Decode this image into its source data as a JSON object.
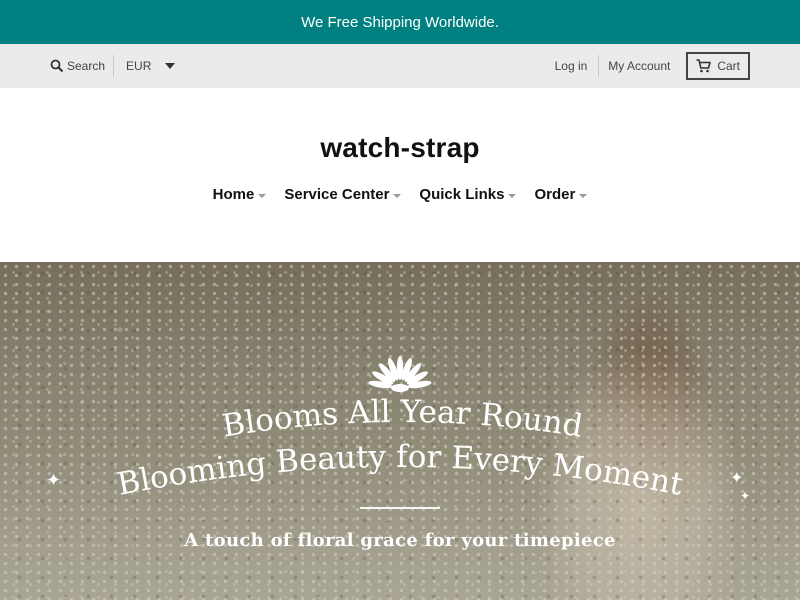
{
  "announcement": {
    "text": "We Free Shipping Worldwide."
  },
  "utility": {
    "search_label": "Search",
    "currency": "EUR",
    "login_label": "Log in",
    "account_label": "My Account",
    "cart_label": "Cart"
  },
  "brand": {
    "name": "watch-strap"
  },
  "nav": {
    "items": [
      {
        "label": "Home"
      },
      {
        "label": "Service Center"
      },
      {
        "label": "Quick Links"
      },
      {
        "label": "Order"
      }
    ]
  },
  "hero": {
    "heading_line1": "Blooms All Year Round",
    "heading_line2": "Blooming Beauty for Every Moment",
    "subheading": "A touch of floral grace for your timepiece"
  },
  "colors": {
    "announcement_bg": "#008080",
    "utility_bg": "#ebebeb"
  }
}
